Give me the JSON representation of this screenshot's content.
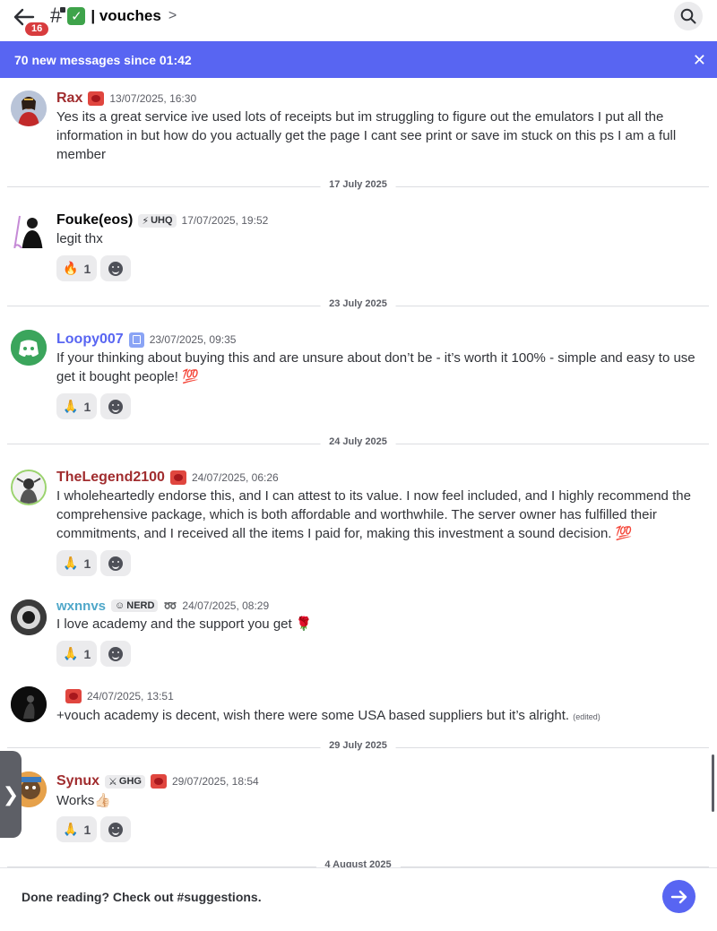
{
  "header": {
    "unread_count": "16",
    "channel_name": "| vouches",
    "check_glyph": "✓",
    "chevron": ">",
    "icons": [
      "back-arrow-icon",
      "hash-lock-icon",
      "check-emoji-icon",
      "search-icon"
    ]
  },
  "banner": {
    "text": "70 new messages since 01:42",
    "close": "✕"
  },
  "messages": [
    {
      "username": "Rax",
      "username_color": "#a12d2f",
      "timestamp": "13/07/2025, 16:30",
      "text": "Yes its a great service ive used lots of receipts but im struggling to figure out the emulators I put all the information in but how do you actually get the page I cant see print or save im stuck on this ps I am a full member"
    },
    {
      "username": "Fouke(eos)",
      "username_color": "#060607",
      "tag": "UHQ",
      "tag_glyph": "⚡",
      "timestamp": "17/07/2025, 19:52",
      "text": "legit thx",
      "reaction": {
        "emoji": "🔥",
        "count": "1"
      }
    },
    {
      "username": "Loopy007",
      "username_color": "#5865f2",
      "timestamp": "23/07/2025, 09:35",
      "text": "If your thinking about buying this and are unsure about don’t be - it’s worth it 100% - simple and easy to use get it bought people! 💯",
      "reaction": {
        "emoji": "🙏",
        "count": "1"
      }
    },
    {
      "username": "TheLegend2100",
      "username_color": "#a12d2f",
      "timestamp": "24/07/2025, 06:26",
      "text": "I wholeheartedly endorse this, and I can attest to its value. I now feel included, and I highly recommend the comprehensive package, which is both affordable and worthwhile. The server owner has fulfilled their commitments, and I received all the items I paid for, making this investment a sound decision. 💯",
      "reaction": {
        "emoji": "🙏",
        "count": "1"
      }
    },
    {
      "username": "wxnnvs",
      "username_color": "#4fa7c9",
      "tag": "NERD",
      "tag_glyph": "☺",
      "extra_glyph": "➿",
      "timestamp": "24/07/2025, 08:29",
      "text": "I love academy and the support you get 🌹",
      "reaction": {
        "emoji": "🙏",
        "count": "1"
      }
    },
    {
      "username": "",
      "timestamp": "24/07/2025, 13:51",
      "text": "+vouch academy is decent, wish there were some USA based suppliers but it’s alright.",
      "edited": "(edited)"
    },
    {
      "username": "Synux",
      "username_color": "#a12d2f",
      "tag": "GHG",
      "tag_glyph": "⚔",
      "timestamp": "29/07/2025, 18:54",
      "text": "Works👍🏻",
      "reaction": {
        "emoji": "🙏",
        "count": "1"
      }
    }
  ],
  "dividers": [
    "17 July 2025",
    "23 July 2025",
    "24 July 2025",
    "29 July 2025",
    "4 August 2025"
  ],
  "side_tab": "❯",
  "footer": {
    "text": "Done reading? Check out #suggestions.",
    "go_icon": "arrow-right-icon"
  },
  "colors": {
    "accent": "#5865f2",
    "badge": "#d83c3e"
  }
}
